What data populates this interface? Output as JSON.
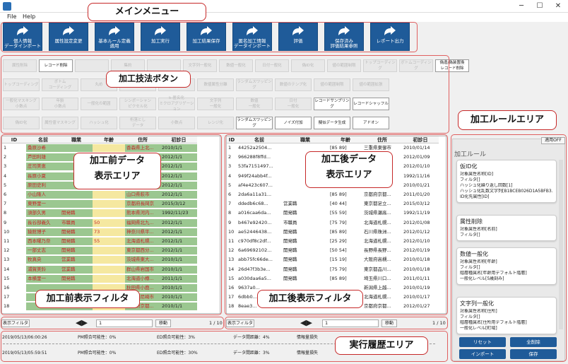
{
  "menu": {
    "file": "File",
    "help": "Help"
  },
  "toolbar": [
    {
      "name": "personal-import",
      "label": "個人情報\nデータインポート"
    },
    {
      "name": "attr-change",
      "label": "属性設定変更"
    },
    {
      "name": "basic-rule",
      "label": "基本ルール定義\n適用"
    },
    {
      "name": "process-run",
      "label": "加工実行"
    },
    {
      "name": "process-save",
      "label": "加工結果保存"
    },
    {
      "name": "anon-import",
      "label": "匿名加工情報\nデータインポート"
    },
    {
      "name": "evaluate",
      "label": "評価"
    },
    {
      "name": "save-eval",
      "label": "保存済み\n評価結果参照"
    },
    {
      "name": "report",
      "label": "レポート出力"
    }
  ],
  "tech": {
    "r1": [
      "属性削除",
      "レコード削除",
      "",
      "集約",
      "",
      "文字列一般化",
      "数値一般化",
      "日付一般化",
      "偽ID化",
      "値の範囲制限",
      "トップコーディング",
      "ボトムコーディング",
      "偽造/偽装置換\nレコード削除"
    ],
    "r2": [
      "トップコーディング",
      "ボトム\nコーディング",
      "丸め",
      "階層一般化",
      "数値属性再入",
      "数値属性分離",
      "ランダムスワッピング",
      "数値のテンプ化",
      "値の範囲制限",
      "値の範囲拡張"
    ],
    "r3": [
      "一般化マスキング\n小数点",
      "年齢\n小数点",
      "一般化の範囲",
      "シンポーシャン\nピクセル化",
      "k-匿名化\nミクロアグリゲーション",
      "文字列\n一般化",
      "数値\n一般化",
      "日付\n一般化",
      "レコードサンプリング",
      "レコードシャッフル"
    ],
    "r4": [
      "偽ID化",
      "属性値マスキング",
      "ハッシュ化",
      "桁落とし\nデータ",
      "小数点",
      "レンジ化",
      "ランダムスワッピング",
      "ノイズ付加",
      "擬似データ生成",
      "アドオン"
    ]
  },
  "pre_table": {
    "headers": [
      "ID",
      "名前",
      "職業",
      "年齢",
      "住所",
      "初診日"
    ],
    "rows": [
      [
        "1",
        "桑原沙希",
        "",
        "",
        "香森県上北...",
        "2010/1/1"
      ],
      [
        "2",
        "芦田利雄",
        "",
        "",
        "香知県高知市",
        "2012/1/1"
      ],
      [
        "3",
        "庄司美恵",
        "",
        "",
        "大阪府東大...",
        "2012/1/1"
      ],
      [
        "4",
        "長原小夏",
        "",
        "",
        "東京都足立...",
        "2012/1/1"
      ],
      [
        "5",
        "原田史利",
        "",
        "",
        "大分県香宮...",
        "2012/1/1"
      ],
      [
        "6",
        "小山隆人",
        "",
        "",
        "山口県萩市",
        "2012/1/1"
      ],
      [
        "7",
        "東野里一",
        "",
        "",
        "京都府長岡京",
        "2015/3/12"
      ],
      [
        "8",
        "須部久男",
        "開発職",
        "",
        "熊本県河内...",
        "1992/11/23"
      ],
      [
        "9",
        "長谷部義久",
        "市職員",
        "50",
        "福岡県北九...",
        "2012/1/1"
      ],
      [
        "10",
        "猿館博子",
        "開発職",
        "73",
        "神奈川県平...",
        "2012/1/1"
      ],
      [
        "11",
        "西本曜乃奈",
        "開発職",
        "55",
        "北海道札幌...",
        "2012/1/1"
      ],
      [
        "12",
        "一部丈志",
        "開発職",
        "",
        "東京都西分...",
        "2012/1/1"
      ],
      [
        "13",
        "牧真央",
        "営業職",
        "",
        "茨城県東大...",
        "2010/1/1"
      ],
      [
        "14",
        "浦賀美鈴",
        "営業職",
        "",
        "群山県岩国市",
        "2010/1/1"
      ],
      [
        "15",
        "本横里一",
        "開発職",
        "",
        "北海道小樽...",
        "2011/1/1"
      ],
      [
        "16",
        "",
        "",
        "",
        "秋田県小鹿...",
        "2010/1/1"
      ],
      [
        "17",
        "",
        "",
        "",
        "兵庫県尼崎市",
        "2010/1/1"
      ],
      [
        "18",
        "",
        "",
        "",
        "京都府京都...",
        "2010/1/1"
      ]
    ]
  },
  "post_table": {
    "headers": [
      "ID",
      "名前",
      "職業",
      "年齢",
      "住所",
      "初診日"
    ],
    "rows": [
      [
        "1",
        "44252a2504...",
        "",
        "[85 89]",
        "三重県東御市",
        "2010/01/14"
      ],
      [
        "2",
        "966288f8ffd...",
        "",
        "[85 89]",
        "東京都江戸...",
        "2012/01/09"
      ],
      [
        "3",
        "53fa7151497...",
        "",
        "[65 69]",
        "大阪府東大...",
        "2012/01/10"
      ],
      [
        "4",
        "949f24abb4f...",
        "",
        "[30 34]",
        "東京都足立...",
        "1992/11/16"
      ],
      [
        "5",
        "af4e423c607...",
        "",
        "[40 44]",
        "東京都江戸...",
        "2010/01/21"
      ],
      [
        "6",
        "2da6a11a31...",
        "",
        "[85 89]",
        "京都府京都...",
        "2011/01/20"
      ],
      [
        "7",
        "ddedb6c68...",
        "営業職",
        "[40 44]",
        "東京都足立...",
        "2015/03/12"
      ],
      [
        "8",
        "a016caa6da...",
        "開発職",
        "[55 59]",
        "茨城県瀬高...",
        "1992/11/19"
      ],
      [
        "9",
        "b467e92420...",
        "市職員",
        "[75 79]",
        "北海道札幌...",
        "2012/01/08"
      ],
      [
        "10",
        "ae52446438...",
        "開発職",
        "[85 89]",
        "石川県珠洲...",
        "2012/01/12"
      ],
      [
        "11",
        "c970df8c2df...",
        "開発職",
        "[25 29]",
        "北海道札幌...",
        "2012/01/10"
      ],
      [
        "12",
        "6a69692102...",
        "開発職",
        "[50 54]",
        "長野県長野...",
        "2012/01/19"
      ],
      [
        "13",
        "abb75fc66de...",
        "開発職",
        "[15 19]",
        "大阪府高槻...",
        "2010/01/18"
      ],
      [
        "14",
        "26d47f3b3e...",
        "開発職",
        "[75 79]",
        "東京都品川...",
        "2010/01/18"
      ],
      [
        "15",
        "a030daa6a5...",
        "開発職",
        "[85 89]",
        "埼玉県川口...",
        "2011/01/11"
      ],
      [
        "16",
        "9637a0...",
        "",
        "",
        "新潟県上越...",
        "2010/01/19"
      ],
      [
        "17",
        "6dbb0...",
        "",
        "",
        "北海道札幌...",
        "2010/01/17"
      ],
      [
        "18",
        "8eae3...",
        "",
        "",
        "京都府京都...",
        "2012/01/27"
      ]
    ]
  },
  "filter": {
    "label": "表示フィルタ",
    "value": "1",
    "move": "移動",
    "pages": "1 / 10"
  },
  "rules": {
    "title": "加工ルール",
    "toggle": "適用OFF",
    "cards": [
      {
        "title": "仮ID化",
        "lines": [
          "対象属性名称[ID]",
          "フィルタ[]",
          "ハッシュ化繰り返し回数[1]",
          "ハッシュ化乱数文字列[B1BCEB026D1A5BFB3...",
          "ID化先属性[ID]"
        ]
      },
      {
        "title": "属性削除",
        "lines": [
          "対象属性名称[名前]",
          "フィルタ[]"
        ]
      },
      {
        "title": "数値一般化",
        "lines": [
          "対象属性名称[年齢]",
          "フィルタ[]",
          "階層種属名[年齢用デフォルト階層]",
          "一般化レベル[5歳刻み]"
        ]
      },
      {
        "title": "文字列一般化",
        "lines": [
          "対象属性名称[住所]",
          "フィルタ[]",
          "階層種属名[住所用デフォルト階層]",
          "一般化レベル[町域]"
        ]
      }
    ],
    "buttons": [
      "リセット",
      "全削除",
      "インポート",
      "保存"
    ]
  },
  "history": [
    {
      "time": "2019/05/13/06:00:26",
      "pm": "PM照合可能性：0%",
      "ed": "ED照合可能性：3%",
      "gap": "データ間距離：4%",
      "info": "情報量損失"
    },
    {
      "time": "2019/05/13/05:59:51",
      "pm": "PM照合可能性：0%",
      "ed": "ED照合可能性：30%",
      "gap": "データ間距離：3%",
      "info": "情報量損失"
    }
  ],
  "callouts": {
    "menu": "メインメニュー",
    "tech": "加工技法ボタン",
    "pre1": "加工前データ",
    "pre2": "表示エリア",
    "post1": "加工後データ",
    "post2": "表示エリア",
    "rule": "加工ルールエリア",
    "pref": "加工前表示フィルタ",
    "postf": "加工後表示フィルタ",
    "hist": "実行履歴エリア"
  },
  "colors": {
    "primary": "#1f5b99",
    "callout_border": "#c62828",
    "green": "#9bc790",
    "orange": "#f2c04a",
    "yellow": "#f5e8a0"
  }
}
